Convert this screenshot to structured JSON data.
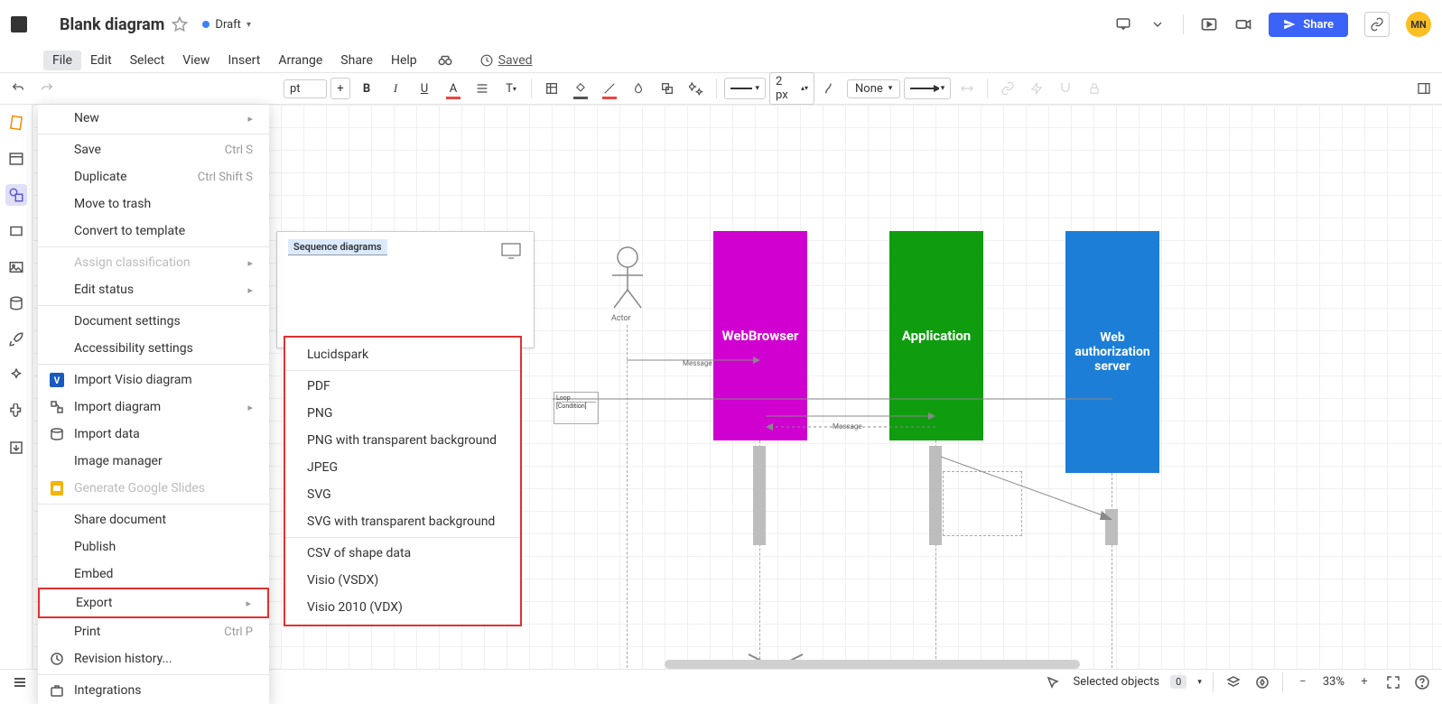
{
  "doc": {
    "title": "Blank diagram",
    "status": "Draft",
    "saved": "Saved"
  },
  "menubar": [
    "File",
    "Edit",
    "Select",
    "View",
    "Insert",
    "Arrange",
    "Share",
    "Help"
  ],
  "toolbar": {
    "font_suffix": "pt",
    "plus": "+",
    "line_width": "2 px",
    "endpoint": "None",
    "zoom_pct": "33%"
  },
  "file_menu": {
    "new": "New",
    "save": "Save",
    "save_sc": "Ctrl S",
    "duplicate": "Duplicate",
    "dup_sc": "Ctrl Shift S",
    "trash": "Move to trash",
    "convert": "Convert to template",
    "classify": "Assign classification",
    "status": "Edit status",
    "doc_settings": "Document settings",
    "a11y": "Accessibility settings",
    "import_visio": "Import Visio diagram",
    "import_diag": "Import diagram",
    "import_data": "Import data",
    "img_mgr": "Image manager",
    "gslides": "Generate Google Slides",
    "share_doc": "Share document",
    "publish": "Publish",
    "embed": "Embed",
    "export": "Export",
    "print": "Print",
    "print_sc": "Ctrl P",
    "revision": "Revision history...",
    "integrations": "Integrations"
  },
  "export_menu": [
    "Lucidspark",
    "PDF",
    "PNG",
    "PNG with transparent background",
    "JPEG",
    "SVG",
    "SVG with transparent background",
    "CSV of shape data",
    "Visio (VSDX)",
    "Visio 2010 (VDX)"
  ],
  "canvas": {
    "seq_label": "Sequence diagrams",
    "actor": "Actor",
    "message": "Message",
    "loop": "Loop",
    "condition": "[Condition]",
    "msg2": "Message",
    "blocks": [
      {
        "label": "WebBrowser"
      },
      {
        "label": "Application"
      },
      {
        "label": "Web authorization server"
      }
    ]
  },
  "status": {
    "selected": "Selected objects",
    "count": "0",
    "zoom": "33%"
  },
  "share": "Share",
  "avatar": "MN"
}
